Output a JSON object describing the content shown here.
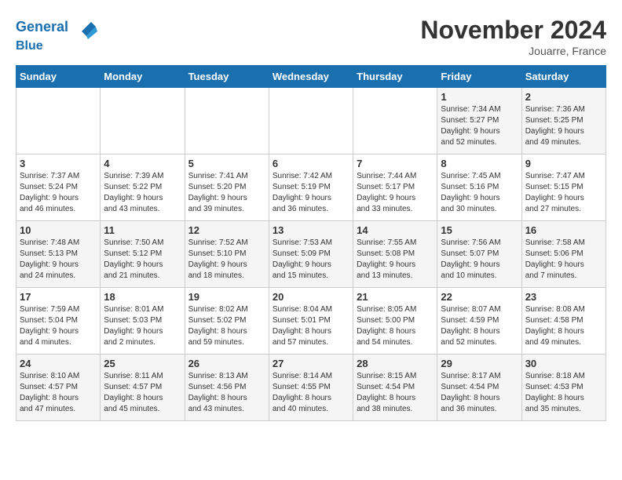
{
  "header": {
    "logo_line1": "General",
    "logo_line2": "Blue",
    "month_title": "November 2024",
    "location": "Jouarre, France"
  },
  "days_of_week": [
    "Sunday",
    "Monday",
    "Tuesday",
    "Wednesday",
    "Thursday",
    "Friday",
    "Saturday"
  ],
  "weeks": [
    [
      {
        "day": "",
        "info": ""
      },
      {
        "day": "",
        "info": ""
      },
      {
        "day": "",
        "info": ""
      },
      {
        "day": "",
        "info": ""
      },
      {
        "day": "",
        "info": ""
      },
      {
        "day": "1",
        "info": "Sunrise: 7:34 AM\nSunset: 5:27 PM\nDaylight: 9 hours\nand 52 minutes."
      },
      {
        "day": "2",
        "info": "Sunrise: 7:36 AM\nSunset: 5:25 PM\nDaylight: 9 hours\nand 49 minutes."
      }
    ],
    [
      {
        "day": "3",
        "info": "Sunrise: 7:37 AM\nSunset: 5:24 PM\nDaylight: 9 hours\nand 46 minutes."
      },
      {
        "day": "4",
        "info": "Sunrise: 7:39 AM\nSunset: 5:22 PM\nDaylight: 9 hours\nand 43 minutes."
      },
      {
        "day": "5",
        "info": "Sunrise: 7:41 AM\nSunset: 5:20 PM\nDaylight: 9 hours\nand 39 minutes."
      },
      {
        "day": "6",
        "info": "Sunrise: 7:42 AM\nSunset: 5:19 PM\nDaylight: 9 hours\nand 36 minutes."
      },
      {
        "day": "7",
        "info": "Sunrise: 7:44 AM\nSunset: 5:17 PM\nDaylight: 9 hours\nand 33 minutes."
      },
      {
        "day": "8",
        "info": "Sunrise: 7:45 AM\nSunset: 5:16 PM\nDaylight: 9 hours\nand 30 minutes."
      },
      {
        "day": "9",
        "info": "Sunrise: 7:47 AM\nSunset: 5:15 PM\nDaylight: 9 hours\nand 27 minutes."
      }
    ],
    [
      {
        "day": "10",
        "info": "Sunrise: 7:48 AM\nSunset: 5:13 PM\nDaylight: 9 hours\nand 24 minutes."
      },
      {
        "day": "11",
        "info": "Sunrise: 7:50 AM\nSunset: 5:12 PM\nDaylight: 9 hours\nand 21 minutes."
      },
      {
        "day": "12",
        "info": "Sunrise: 7:52 AM\nSunset: 5:10 PM\nDaylight: 9 hours\nand 18 minutes."
      },
      {
        "day": "13",
        "info": "Sunrise: 7:53 AM\nSunset: 5:09 PM\nDaylight: 9 hours\nand 15 minutes."
      },
      {
        "day": "14",
        "info": "Sunrise: 7:55 AM\nSunset: 5:08 PM\nDaylight: 9 hours\nand 13 minutes."
      },
      {
        "day": "15",
        "info": "Sunrise: 7:56 AM\nSunset: 5:07 PM\nDaylight: 9 hours\nand 10 minutes."
      },
      {
        "day": "16",
        "info": "Sunrise: 7:58 AM\nSunset: 5:06 PM\nDaylight: 9 hours\nand 7 minutes."
      }
    ],
    [
      {
        "day": "17",
        "info": "Sunrise: 7:59 AM\nSunset: 5:04 PM\nDaylight: 9 hours\nand 4 minutes."
      },
      {
        "day": "18",
        "info": "Sunrise: 8:01 AM\nSunset: 5:03 PM\nDaylight: 9 hours\nand 2 minutes."
      },
      {
        "day": "19",
        "info": "Sunrise: 8:02 AM\nSunset: 5:02 PM\nDaylight: 8 hours\nand 59 minutes."
      },
      {
        "day": "20",
        "info": "Sunrise: 8:04 AM\nSunset: 5:01 PM\nDaylight: 8 hours\nand 57 minutes."
      },
      {
        "day": "21",
        "info": "Sunrise: 8:05 AM\nSunset: 5:00 PM\nDaylight: 8 hours\nand 54 minutes."
      },
      {
        "day": "22",
        "info": "Sunrise: 8:07 AM\nSunset: 4:59 PM\nDaylight: 8 hours\nand 52 minutes."
      },
      {
        "day": "23",
        "info": "Sunrise: 8:08 AM\nSunset: 4:58 PM\nDaylight: 8 hours\nand 49 minutes."
      }
    ],
    [
      {
        "day": "24",
        "info": "Sunrise: 8:10 AM\nSunset: 4:57 PM\nDaylight: 8 hours\nand 47 minutes."
      },
      {
        "day": "25",
        "info": "Sunrise: 8:11 AM\nSunset: 4:57 PM\nDaylight: 8 hours\nand 45 minutes."
      },
      {
        "day": "26",
        "info": "Sunrise: 8:13 AM\nSunset: 4:56 PM\nDaylight: 8 hours\nand 43 minutes."
      },
      {
        "day": "27",
        "info": "Sunrise: 8:14 AM\nSunset: 4:55 PM\nDaylight: 8 hours\nand 40 minutes."
      },
      {
        "day": "28",
        "info": "Sunrise: 8:15 AM\nSunset: 4:54 PM\nDaylight: 8 hours\nand 38 minutes."
      },
      {
        "day": "29",
        "info": "Sunrise: 8:17 AM\nSunset: 4:54 PM\nDaylight: 8 hours\nand 36 minutes."
      },
      {
        "day": "30",
        "info": "Sunrise: 8:18 AM\nSunset: 4:53 PM\nDaylight: 8 hours\nand 35 minutes."
      }
    ]
  ]
}
